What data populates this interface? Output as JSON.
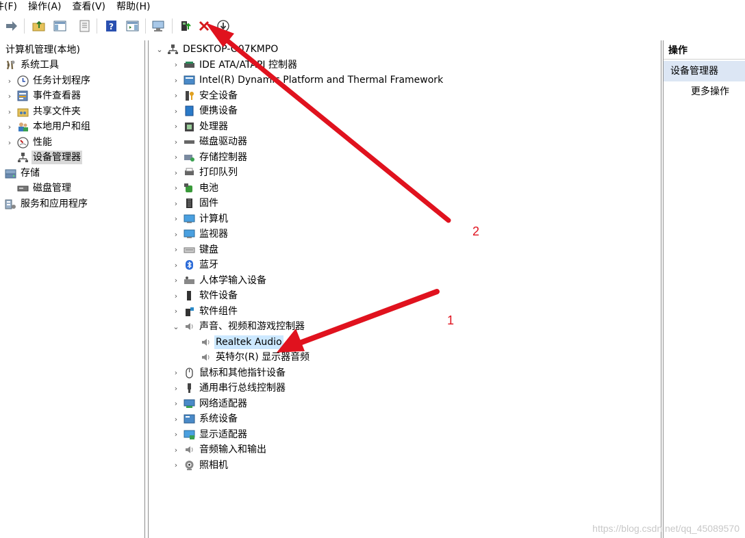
{
  "menu": [
    "件(F)",
    "操作(A)",
    "查看(V)",
    "帮助(H)"
  ],
  "left_tree": [
    {
      "label": "计算机管理(本地)",
      "icon": "computer-management-icon"
    },
    {
      "label": "系统工具",
      "icon": "tools-icon"
    },
    {
      "label": "任务计划程序",
      "icon": "clock-icon"
    },
    {
      "label": "事件查看器",
      "icon": "event-viewer-icon"
    },
    {
      "label": "共享文件夹",
      "icon": "shared-folder-icon"
    },
    {
      "label": "本地用户和组",
      "icon": "users-icon"
    },
    {
      "label": "性能",
      "icon": "performance-icon"
    },
    {
      "label": "设备管理器",
      "icon": "device-manager-icon"
    },
    {
      "label": "存储",
      "icon": "storage-icon"
    },
    {
      "label": "磁盘管理",
      "icon": "disk-icon"
    },
    {
      "label": "服务和应用程序",
      "icon": "services-icon"
    }
  ],
  "device_tree": {
    "root": "DESKTOP-O07KMPO",
    "categories": [
      "IDE ATA/ATAPI 控制器",
      "Intel(R) Dynamic Platform and Thermal Framework",
      "安全设备",
      "便携设备",
      "处理器",
      "磁盘驱动器",
      "存储控制器",
      "打印队列",
      "电池",
      "固件",
      "计算机",
      "监视器",
      "键盘",
      "蓝牙",
      "人体学输入设备",
      "软件设备",
      "软件组件",
      "声音、视频和游戏控制器",
      "鼠标和其他指针设备",
      "通用串行总线控制器",
      "网络适配器",
      "系统设备",
      "显示适配器",
      "音频输入和输出",
      "照相机"
    ],
    "sound_children": [
      "Realtek Audio",
      "英特尔(R) 显示器音频"
    ]
  },
  "actions": {
    "header": "操作",
    "section": "设备管理器",
    "more": "更多操作"
  },
  "annotations": {
    "label1": "1",
    "label2": "2",
    "color": "#e0121e"
  },
  "watermark": "https://blog.csdn.net/qq_45089570"
}
